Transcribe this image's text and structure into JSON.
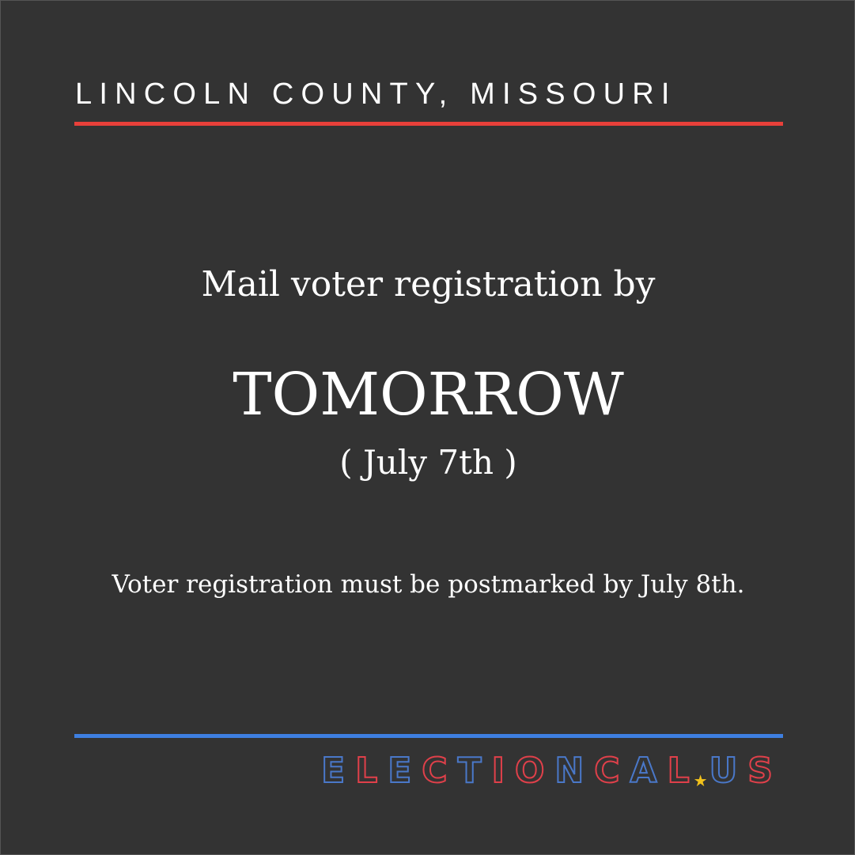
{
  "header": {
    "region": "LINCOLN COUNTY, MISSOURI"
  },
  "main": {
    "headline": "Mail voter registration by",
    "deadline": "TOMORROW",
    "deadline_date": "( July 7th )",
    "note": "Voter registration must be postmarked by July 8th."
  },
  "footer": {
    "brand": [
      {
        "text": "E",
        "color": "#4a78c9"
      },
      {
        "text": "L",
        "color": "#e0404a"
      },
      {
        "text": "E",
        "color": "#4a78c9"
      },
      {
        "text": "C",
        "color": "#e0404a"
      },
      {
        "text": "T",
        "color": "#4a78c9"
      },
      {
        "text": "I",
        "color": "#e0404a"
      },
      {
        "text": "O",
        "color": "#e0404a"
      },
      {
        "text": "N",
        "color": "#4a78c9"
      },
      {
        "text": "C",
        "color": "#e0404a"
      },
      {
        "text": "A",
        "color": "#4a78c9"
      },
      {
        "text": "L",
        "color": "#e0404a"
      }
    ],
    "brand_star": "★",
    "brand_suffix": [
      {
        "text": "U",
        "color": "#4a78c9"
      },
      {
        "text": "S",
        "color": "#e0404a"
      }
    ],
    "brand_text": "ELECTIONCAL.US"
  },
  "colors": {
    "background": "#333333",
    "header_rule": "#e8403a",
    "footer_rule": "#3e7fe0",
    "star": "#f2c21b",
    "text": "#ffffff"
  },
  "icons": {
    "brand_star": "star-icon"
  }
}
